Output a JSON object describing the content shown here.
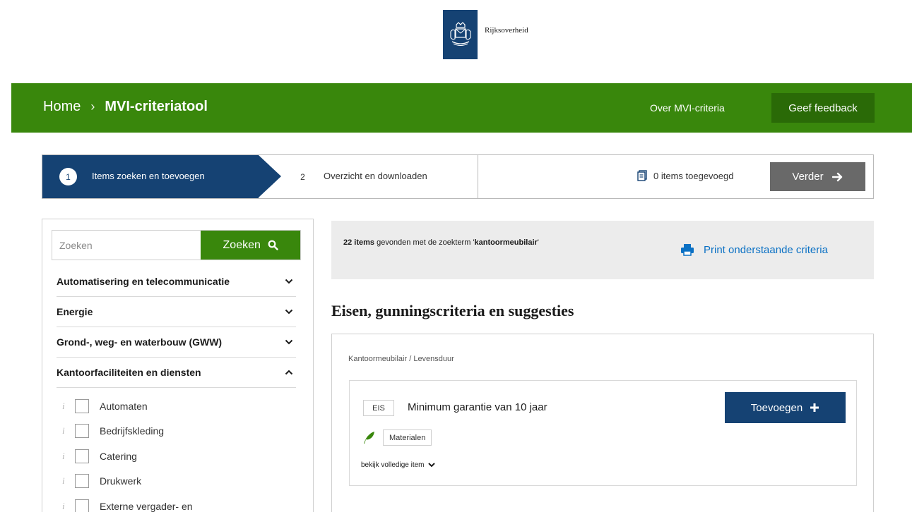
{
  "brand": {
    "name": "Rijksoverheid",
    "color": "#154273"
  },
  "header": {
    "breadcrumb_home": "Home",
    "breadcrumb_current": "MVI-criteriatool",
    "about_link": "Over MVI-criteria",
    "feedback_button": "Geef feedback",
    "color": "#39870c"
  },
  "steps": [
    {
      "number": "1",
      "label": "Items zoeken en toevoegen",
      "active": true
    },
    {
      "number": "2",
      "label": "Overzicht en downloaden",
      "active": false
    }
  ],
  "cart": {
    "label": "0 items toegevoegd",
    "icon": "document-icon"
  },
  "next_button": "Verder",
  "search": {
    "placeholder": "Zoeken",
    "button_label": "Zoeken"
  },
  "categories": [
    {
      "label": "Automatisering en telecommunicatie",
      "expanded": false
    },
    {
      "label": "Energie",
      "expanded": false
    },
    {
      "label": "Grond-, weg- en waterbouw (GWW)",
      "expanded": false
    },
    {
      "label": "Kantoorfaciliteiten en diensten",
      "expanded": true
    }
  ],
  "subcategories": [
    "Automaten",
    "Bedrijfskleding",
    "Catering",
    "Drukwerk",
    "Externe vergader- en"
  ],
  "results": {
    "count_text": "22 items",
    "middle_text": " gevonden met de zoekterm '",
    "term": "kantoormeubilair",
    "end_text": "'"
  },
  "print_link": "Print onderstaande criteria",
  "section_title": "Eisen, gunningscriteria en suggesties",
  "card": {
    "path": "Kantoormeubilair / Levensduur",
    "type_tag": "EIS",
    "title": "Minimum garantie van 10 jaar",
    "add_button": "Toevoegen",
    "tag": "Materialen",
    "more_link": "bekijk volledige item"
  }
}
